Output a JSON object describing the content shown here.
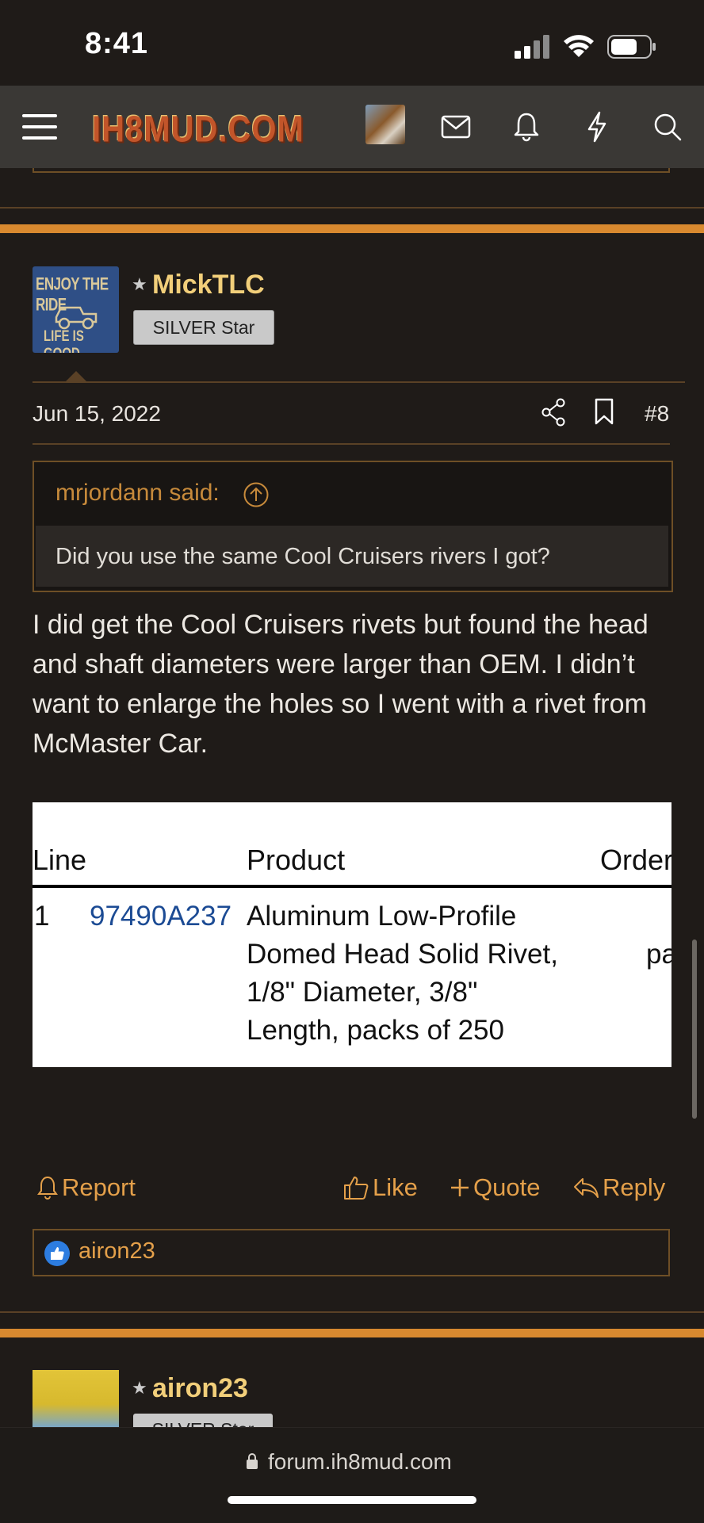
{
  "status": {
    "time": "8:41"
  },
  "nav": {
    "logo": "IH8MUD.COM"
  },
  "post": {
    "avatar_line1": "ENJOY THE RIDE",
    "avatar_line2": "LIFE IS GOOD",
    "username": "MickTLC",
    "rank": "SILVER Star",
    "date": "Jun 15, 2022",
    "number": "#8",
    "quote": {
      "author": "mrjordann said:",
      "text": "Did you use the same Cool Cruisers rivers I got?"
    },
    "body": "I did get the Cool Cruisers rivets but found the head and shaft diameters were larger than OEM. I didn’t want to enlarge the holes so I went with a rivet from McMaster Car.",
    "table": {
      "headers": [
        "Line",
        "Product",
        "Order"
      ],
      "row": {
        "line": "1",
        "part_number": "97490A237",
        "product_lines": [
          "Aluminum Low-Profile",
          "Domed Head Solid Rivet,",
          "1/8\" Diameter, 3/8\"",
          "Length, packs of 250"
        ],
        "order_fragment": "pa"
      }
    },
    "actions": {
      "report": "Report",
      "like": "Like",
      "quote": "Quote",
      "reply": "Reply"
    },
    "reactions": {
      "user": "airon23"
    }
  },
  "next_post": {
    "username": "airon23",
    "rank": "SILVER Star"
  },
  "browser": {
    "url": "forum.ih8mud.com"
  },
  "colors": {
    "accent": "#e4a04a",
    "username": "#f2cf7a",
    "separator": "#d8892f",
    "background": "#1f1b18"
  }
}
